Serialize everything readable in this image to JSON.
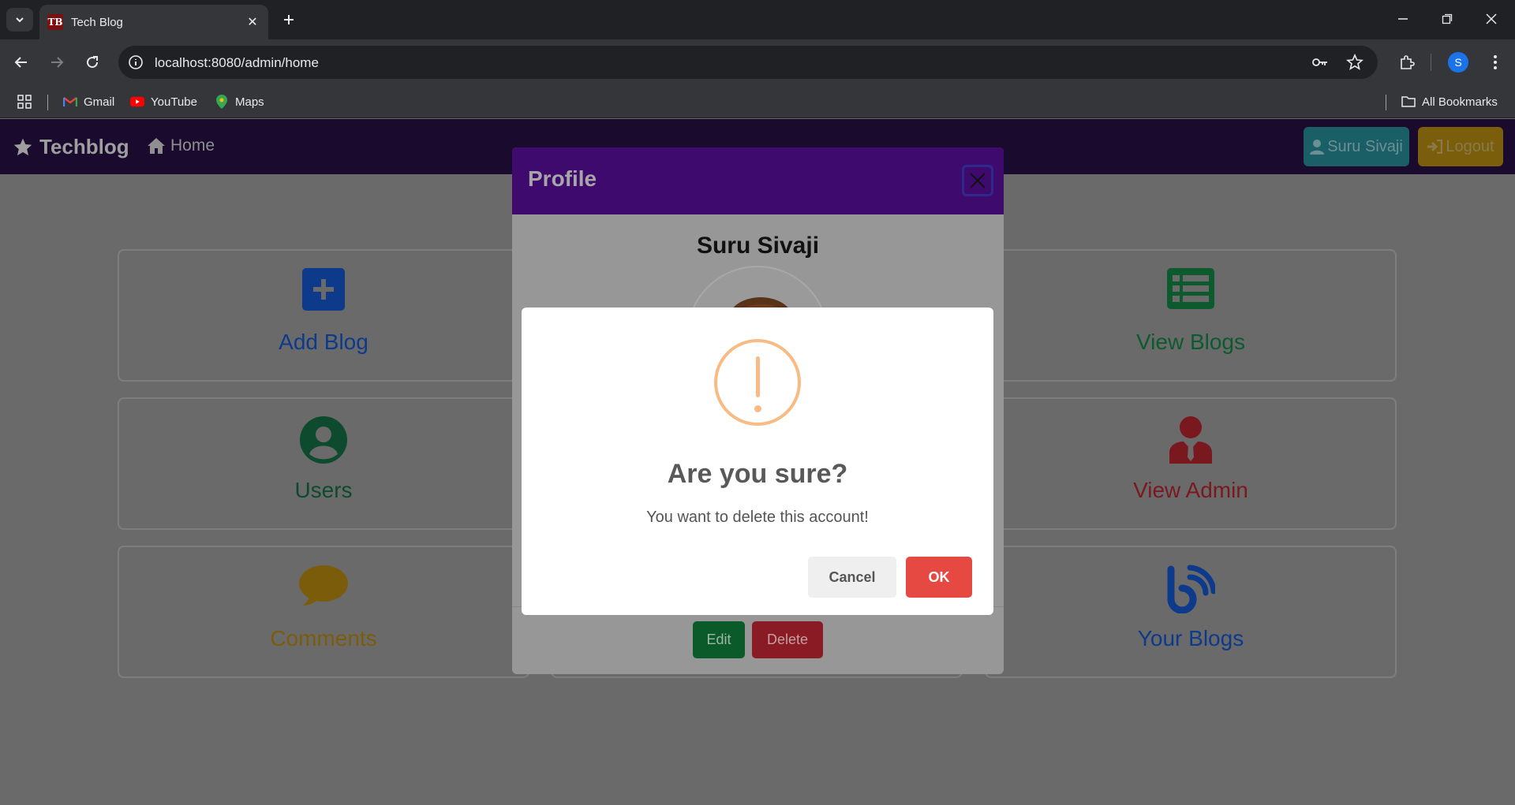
{
  "browser": {
    "tab_title": "Tech Blog",
    "favicon_text": "TB",
    "url": "localhost:8080/admin/home",
    "profile_initial": "S",
    "bookmarks": [
      {
        "label": "Gmail",
        "icon": "gmail-icon"
      },
      {
        "label": "YouTube",
        "icon": "youtube-icon"
      },
      {
        "label": "Maps",
        "icon": "maps-icon"
      }
    ],
    "all_bookmarks": "All Bookmarks"
  },
  "site": {
    "brand": "Techblog",
    "home": "Home",
    "user_button": "Suru Sivaji",
    "logout_button": "Logout"
  },
  "cards": [
    {
      "label": "Add Blog",
      "icon": "plus-square-icon",
      "color": "#0d3a8a"
    },
    {
      "label": "View Blogs",
      "icon": "list-icon",
      "color": "#0d5a2e"
    },
    {
      "label": "Users",
      "icon": "user-circle-icon",
      "color": "#0d4a2e"
    },
    {
      "label": "View Admin",
      "icon": "user-tie-icon",
      "color": "#7a1820"
    },
    {
      "label": "Comments",
      "icon": "comment-icon",
      "color": "#7a5c0a"
    },
    {
      "label": "Your Blogs",
      "icon": "blog-icon",
      "color": "#0d3a8a"
    }
  ],
  "profile_modal": {
    "title": "Profile",
    "name": "Suru Sivaji",
    "edit_label": "Edit",
    "delete_label": "Delete"
  },
  "alert": {
    "icon": "warning-icon",
    "title": "Are you sure?",
    "text": "You want to delete this account!",
    "cancel_label": "Cancel",
    "ok_label": "OK",
    "ok_color": "#e64942",
    "icon_color": "#f8bb86"
  }
}
